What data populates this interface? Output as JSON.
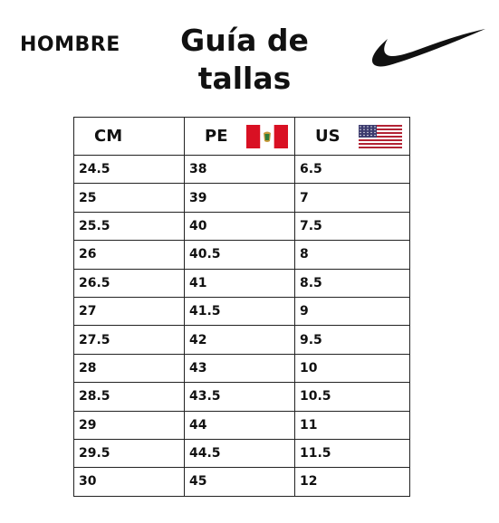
{
  "header": {
    "gender": "HOMBRE",
    "title_line1": "Guía de",
    "title_line2": "tallas"
  },
  "logo": {
    "icon": "swoosh-logo-icon"
  },
  "table": {
    "columns": [
      {
        "label": "CM",
        "flag": null
      },
      {
        "label": "PE",
        "flag": "peru-flag-icon"
      },
      {
        "label": "US",
        "flag": "usa-flag-icon"
      }
    ],
    "rows": [
      [
        "24.5",
        "38",
        "6.5"
      ],
      [
        "25",
        "39",
        "7"
      ],
      [
        "25.5",
        "40",
        "7.5"
      ],
      [
        "26",
        "40.5",
        "8"
      ],
      [
        "26.5",
        "41",
        "8.5"
      ],
      [
        "27",
        "41.5",
        "9"
      ],
      [
        "27.5",
        "42",
        "9.5"
      ],
      [
        "28",
        "43",
        "10"
      ],
      [
        "28.5",
        "43.5",
        "10.5"
      ],
      [
        "29",
        "44",
        "11"
      ],
      [
        "29.5",
        "44.5",
        "11.5"
      ],
      [
        "30",
        "45",
        "12"
      ]
    ]
  },
  "colors": {
    "peru_red": "#D91023",
    "usa_red": "#B22234",
    "usa_blue": "#3C3B6E",
    "text": "#111111"
  }
}
